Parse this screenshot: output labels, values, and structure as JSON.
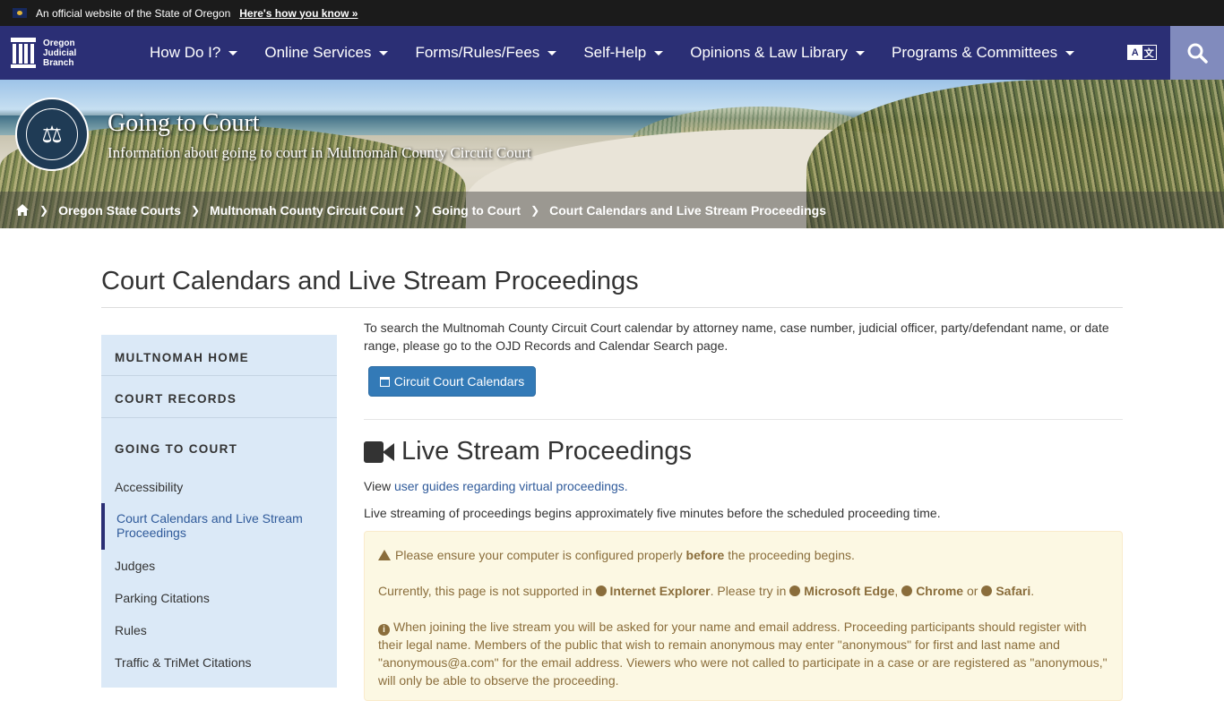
{
  "official": {
    "text": "An official website of the State of Oregon",
    "link": "Here's how you know »"
  },
  "logo": {
    "line1": "Oregon",
    "line2": "Judicial",
    "line3": "Branch"
  },
  "nav": {
    "items": [
      "How Do I?",
      "Online Services",
      "Forms/Rules/Fees",
      "Self-Help",
      "Opinions & Law Library",
      "Programs & Committees"
    ],
    "translate": [
      "A",
      "文"
    ]
  },
  "hero": {
    "title": "Going to Court",
    "subtitle": "Information about going to court in Multnomah County Circuit Court"
  },
  "breadcrumbs": [
    "Oregon State Courts",
    "Multnomah County Circuit Court",
    "Going to Court",
    "Court Calendars and Live Stream Proceedings"
  ],
  "page": {
    "title": "Court Calendars and Live Stream Proceedings"
  },
  "sidebar": {
    "headers": [
      "MULTNOMAH HOME",
      "COURT RECORDS",
      "GOING TO COURT"
    ],
    "links": [
      "Accessibility",
      "Court Calendars and Live Stream Proceedings",
      "Judges",
      "Parking Citations",
      "Rules",
      "Traffic & TriMet Citations"
    ]
  },
  "main": {
    "intro": "To search the Multnomah County Circuit Court calendar by attorney name, case number, judicial officer, party/defendant name, or date range, please go to the OJD Records and Calendar Search page.",
    "calendar_button": "Circuit Court Calendars",
    "live_heading": "Live Stream Proceedings",
    "view_prefix": "View ",
    "view_link": "user guides regarding virtual proceedings.",
    "stream_text": "Live streaming of proceedings begins approximately five minutes before the scheduled proceeding time."
  },
  "alert": {
    "p1_a": "Please ensure your computer is configured properly ",
    "p1_b": "before",
    "p1_c": " the proceeding begins.",
    "p2_a": "Currently, this page is not supported in ",
    "p2_ie": "Internet Explorer",
    "p2_b": ". Please try in ",
    "p2_edge": "Microsoft Edge",
    "p2_comma": ", ",
    "p2_chrome": "Chrome",
    "p2_or": " or ",
    "p2_safari": "Safari",
    "p2_end": ".",
    "p3": "When joining the live stream you will be asked for your name and email address. Proceeding participants should register with their legal name. Members of the public that wish to remain anonymous may enter \"anonymous\" for first and last name and \"anonymous@a.com\" for the email address. Viewers who were not called to participate in a case or are registered as \"anonymous,\" will only be able to observe the proceeding."
  }
}
